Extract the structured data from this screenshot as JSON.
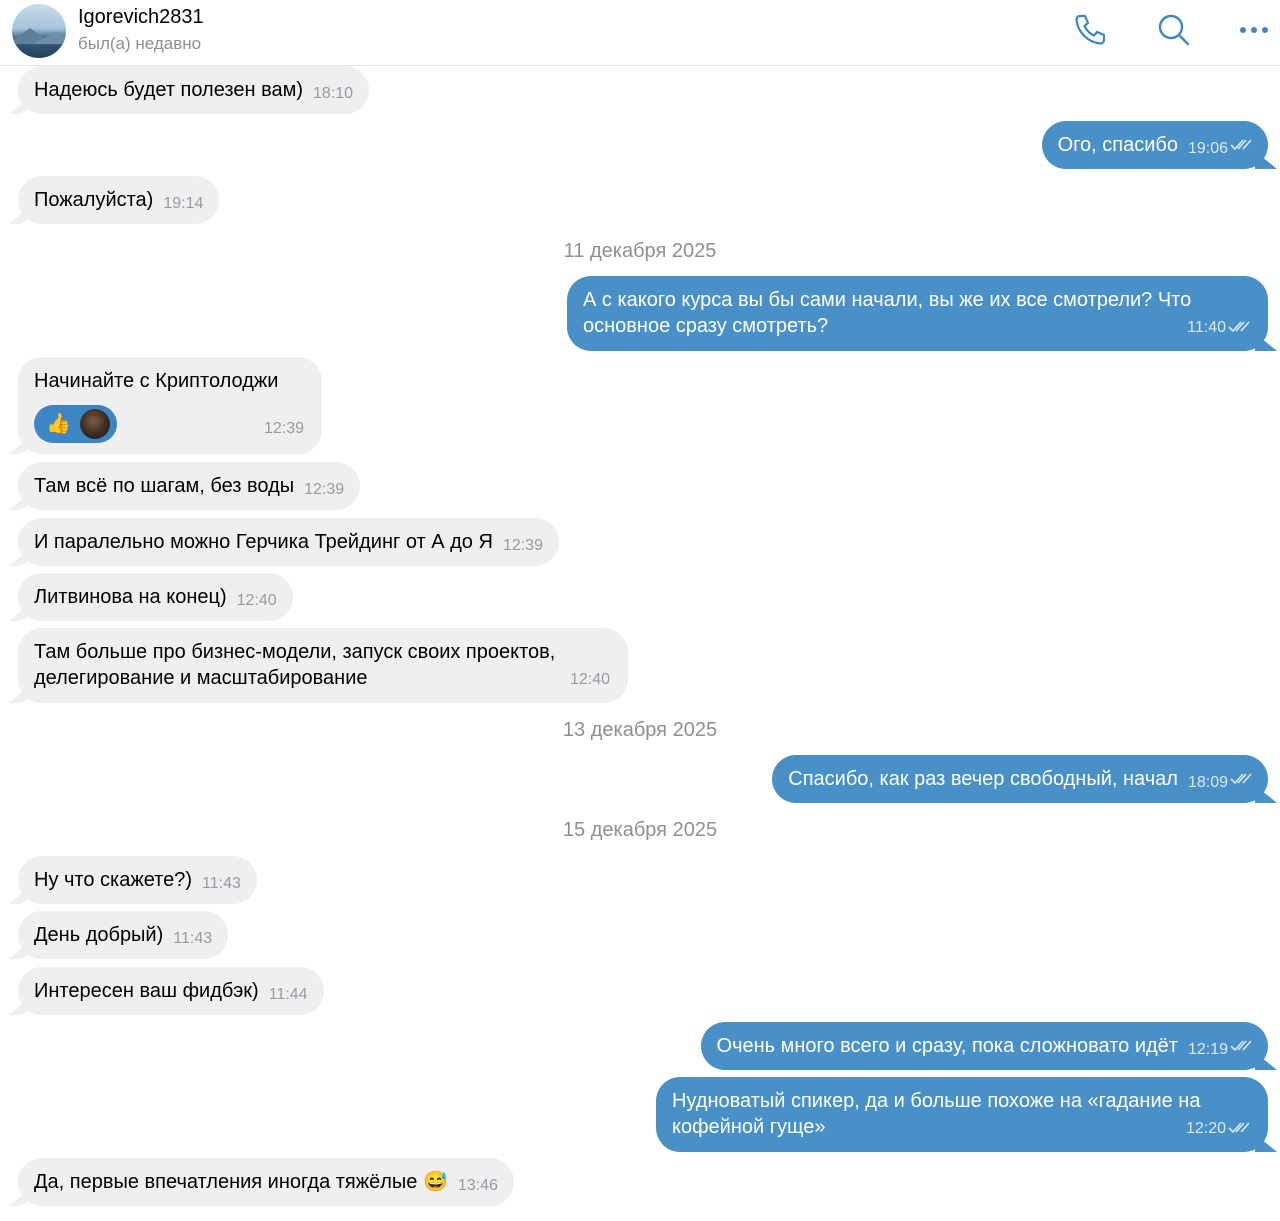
{
  "header": {
    "contact_name": "Igorevich2831",
    "status": "был(а) недавно",
    "icons": [
      "phone-icon",
      "search-icon",
      "more-icon"
    ]
  },
  "colors": {
    "outgoing_bubble": "#4a90c8",
    "incoming_bubble": "#efeff1",
    "icon_accent": "#3d86c5"
  },
  "messages": [
    {
      "dir": "in",
      "text": "Надеюсь будет полезен вам)",
      "time": "18:10"
    },
    {
      "dir": "out",
      "text": "Ого, спасибо",
      "time": "19:06",
      "read": true
    },
    {
      "dir": "in",
      "text": "Пожалуйста)",
      "time": "19:14"
    },
    {
      "dir": "out",
      "text": "А с какого курса вы бы сами начали, вы же их все смотрели? Что основное сразу смотреть?",
      "time": "11:40",
      "read": true
    },
    {
      "dir": "in",
      "text": "Начинайте с Криптолоджи",
      "time": "12:39",
      "reaction": "👍"
    },
    {
      "dir": "in",
      "text": "Там всё по шагам, без воды",
      "time": "12:39"
    },
    {
      "dir": "in",
      "text": "И паралельно можно Герчика Трейдинг от А до Я",
      "time": "12:39"
    },
    {
      "dir": "in",
      "text": "Литвинова на конец)",
      "time": "12:40"
    },
    {
      "dir": "in",
      "text": "Там больше про бизнес-модели, запуск своих проектов, делегирование и масштабирование",
      "time": "12:40"
    },
    {
      "dir": "out",
      "text": "Спасибо, как раз вечер свободный, начал",
      "time": "18:09",
      "read": true
    },
    {
      "dir": "in",
      "text": "Ну что скажете?)",
      "time": "11:43"
    },
    {
      "dir": "in",
      "text": "День добрый)",
      "time": "11:43"
    },
    {
      "dir": "in",
      "text": "Интересен ваш фидбэк)",
      "time": "11:44"
    },
    {
      "dir": "out",
      "text": "Очень много всего и сразу, пока сложновато идёт",
      "time": "12:19",
      "read": true
    },
    {
      "dir": "out",
      "text": "Нудноватый спикер, да и больше похоже на «гадание на кофейной гуще»",
      "time": "12:20",
      "read": true
    },
    {
      "dir": "in",
      "text": "Да, первые впечатления иногда тяжёлые 😅",
      "time": "13:46"
    }
  ],
  "dates": [
    "11 декабря 2025",
    "13 декабря 2025",
    "15 декабря 2025"
  ]
}
